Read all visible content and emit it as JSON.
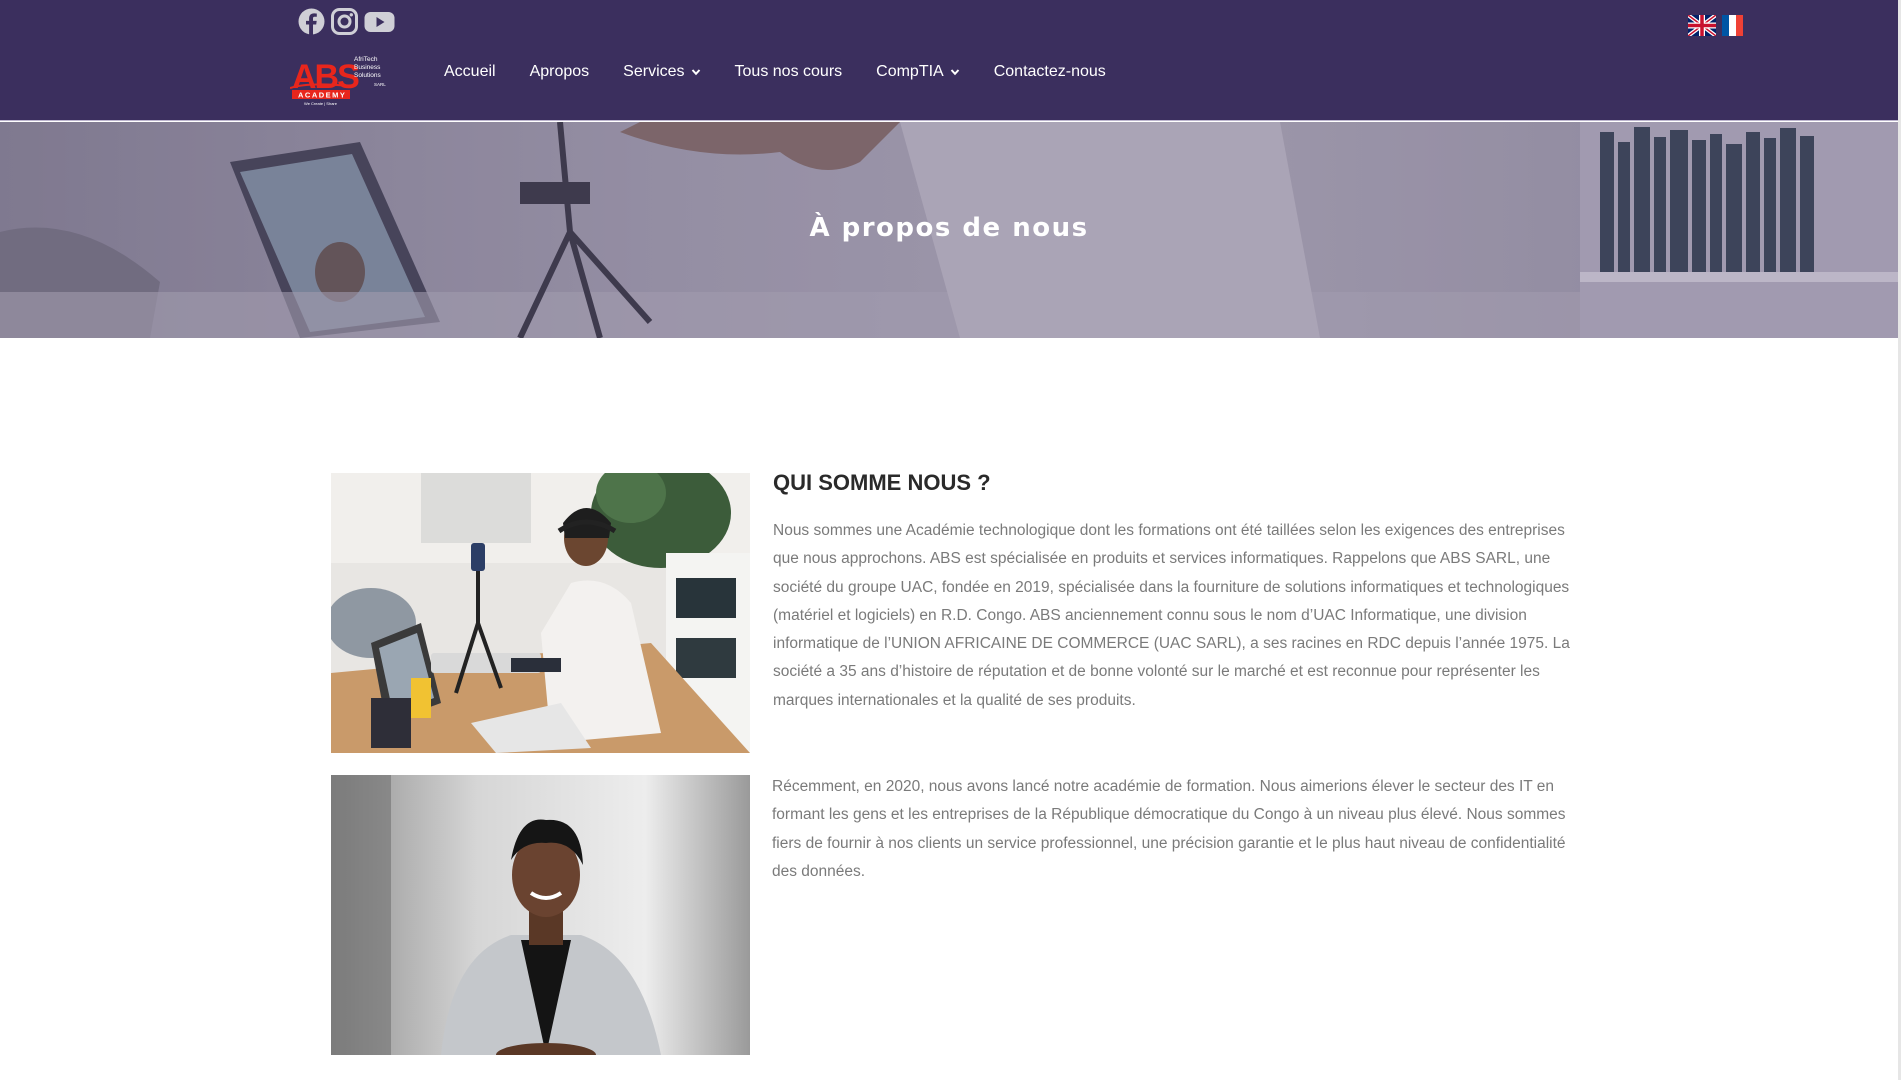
{
  "header": {
    "social": [
      "facebook-icon",
      "instagram-icon",
      "youtube-icon"
    ],
    "logo": {
      "main": "ABS",
      "sub_lines": [
        "AfriTech",
        "Business",
        "Solutions",
        "SARL"
      ],
      "badge": "ACADEMY",
      "tagline": "We Create | Share"
    },
    "nav": [
      {
        "label": "Accueil",
        "dropdown": false
      },
      {
        "label": "Apropos",
        "dropdown": false
      },
      {
        "label": "Services",
        "dropdown": true
      },
      {
        "label": "Tous nos cours",
        "dropdown": false
      },
      {
        "label": "CompTIA",
        "dropdown": true
      },
      {
        "label": "Contactez-nous",
        "dropdown": false
      }
    ],
    "languages": [
      "uk-flag-icon",
      "fr-flag-icon"
    ]
  },
  "hero": {
    "title": "À propos de nous"
  },
  "about": {
    "title": "QUI SOMME NOUS ?",
    "paragraph1": "Nous sommes une Académie technologique dont les formations ont été taillées selon les exigences des entreprises que nous approchons. ABS est spécialisée en produits et services informatiques. Rappelons que ABS SARL, une société du groupe UAC, fondée en 2019, spécialisée dans la fourniture de solutions informatiques et technologiques (matériel et logiciels) en R.D. Congo. ABS anciennement connu sous le nom d’UAC Informatique, une division informatique de l’UNION AFRICAINE DE COMMERCE (UAC SARL), a ses racines en RDC depuis l’année 1975. La société a 35 ans d’histoire de réputation et de bonne volonté sur le marché et est reconnue pour représenter les marques internationales et la qualité de ses produits.",
    "paragraph2": "Récemment, en 2020, nous avons lancé notre académie de formation. Nous aimerions élever le secteur des IT en formant les gens et les entreprises de la République démocratique du Congo à un niveau plus élevé. Nous sommes fiers de fournir à nos clients un service professionnel, une précision garantie et le plus haut niveau de confidentialité des données."
  },
  "colors": {
    "header_bg": "#3b2f5e",
    "text_gray": "#7a7a7a",
    "logo_red": "#e8261c"
  }
}
